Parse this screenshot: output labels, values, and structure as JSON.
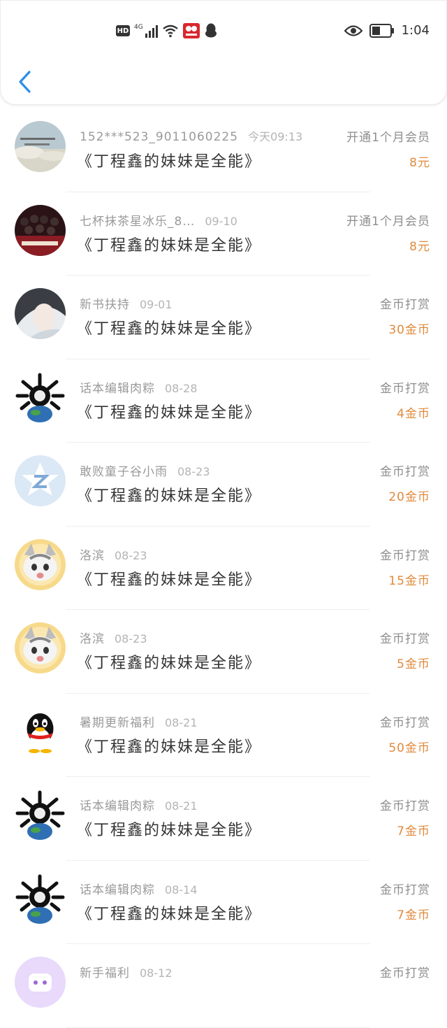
{
  "status_bar": {
    "hd": "HD",
    "network": "4G",
    "time": "1:04"
  },
  "header": {
    "back_icon": "chevron-left-icon"
  },
  "records": [
    {
      "name": "152***523_9011060225",
      "date": "今天09:13",
      "book": "《丁程鑫的妹妹是全能》",
      "type": "开通1个月会员",
      "amount": "8元",
      "avatar": "sky-photo"
    },
    {
      "name": "七杯抹茶星冰乐_8…",
      "date": "09-10",
      "book": "《丁程鑫的妹妹是全能》",
      "type": "开通1个月会员",
      "amount": "8元",
      "avatar": "group-photo"
    },
    {
      "name": "新书扶持",
      "date": "09-01",
      "book": "《丁程鑫的妹妹是全能》",
      "type": "金币打赏",
      "amount": "30金币",
      "avatar": "anime-portrait"
    },
    {
      "name": "话本编辑肉粽",
      "date": "08-28",
      "book": "《丁程鑫的妹妹是全能》",
      "type": "金币打赏",
      "amount": "4金币",
      "avatar": "skull-globe"
    },
    {
      "name": "敢败童子谷小雨",
      "date": "08-23",
      "book": "《丁程鑫的妹妹是全能》",
      "type": "金币打赏",
      "amount": "20金币",
      "avatar": "z-logo"
    },
    {
      "name": "洛滨",
      "date": "08-23",
      "book": "《丁程鑫的妹妹是全能》",
      "type": "金币打赏",
      "amount": "15金币",
      "avatar": "cat"
    },
    {
      "name": "洛滨",
      "date": "08-23",
      "book": "《丁程鑫的妹妹是全能》",
      "type": "金币打赏",
      "amount": "5金币",
      "avatar": "cat"
    },
    {
      "name": "暑期更新福利",
      "date": "08-21",
      "book": "《丁程鑫的妹妹是全能》",
      "type": "金币打赏",
      "amount": "50金币",
      "avatar": "penguin"
    },
    {
      "name": "话本编辑肉粽",
      "date": "08-21",
      "book": "《丁程鑫的妹妹是全能》",
      "type": "金币打赏",
      "amount": "7金币",
      "avatar": "skull-globe"
    },
    {
      "name": "话本编辑肉粽",
      "date": "08-14",
      "book": "《丁程鑫的妹妹是全能》",
      "type": "金币打赏",
      "amount": "7金币",
      "avatar": "skull-globe"
    },
    {
      "name": "新手福利",
      "date": "08-12",
      "book": "",
      "type": "金币打赏",
      "amount": "",
      "avatar": "purple-bot"
    }
  ]
}
